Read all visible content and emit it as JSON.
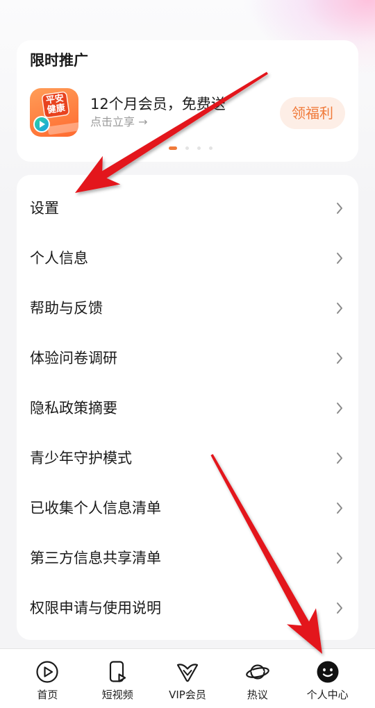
{
  "promo": {
    "title": "限时推广",
    "app_icon": {
      "line1": "平安",
      "line2": "健康"
    },
    "headline": "12个月会员，免费送",
    "subtext": "点击立享 →",
    "button_label": "领福利",
    "carousel": {
      "pages": 4,
      "current": 1
    }
  },
  "menu": {
    "items": [
      {
        "label": "设置"
      },
      {
        "label": "个人信息"
      },
      {
        "label": "帮助与反馈"
      },
      {
        "label": "体验问卷调研"
      },
      {
        "label": "隐私政策摘要"
      },
      {
        "label": "青少年守护模式"
      },
      {
        "label": "已收集个人信息清单"
      },
      {
        "label": "第三方信息共享清单"
      },
      {
        "label": "权限申请与使用说明"
      }
    ]
  },
  "tabbar": {
    "items": [
      {
        "label": "首页",
        "icon": "play-circle-icon",
        "active": false
      },
      {
        "label": "短视频",
        "icon": "short-video-icon",
        "active": false
      },
      {
        "label": "VIP会员",
        "icon": "vip-crown-icon",
        "active": false
      },
      {
        "label": "热议",
        "icon": "planet-icon",
        "active": false
      },
      {
        "label": "个人中心",
        "icon": "smiley-face-icon",
        "active": true
      }
    ]
  },
  "colors": {
    "accent": "#f07a3a",
    "button_bg": "#fdeee6",
    "annotation_arrow": "#e3151c"
  }
}
